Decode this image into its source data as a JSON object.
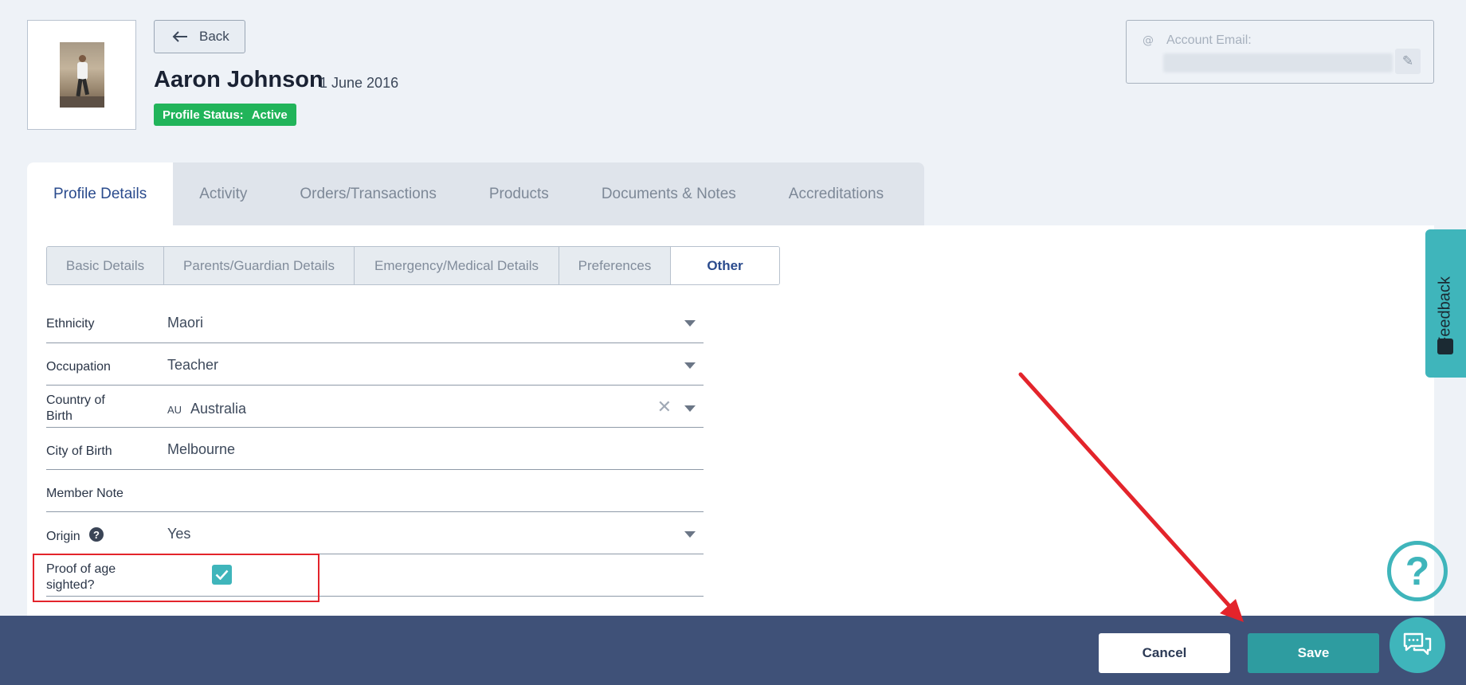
{
  "header": {
    "back_label": "Back",
    "name": "Aaron Johnson",
    "dob": "1 June 2016",
    "status_label": "Profile Status:",
    "status_value": "Active",
    "account_email_label": "Account Email:",
    "account_email_value": "••••••••••••••••••••••••"
  },
  "main_tabs": [
    {
      "label": "Profile Details",
      "active": true
    },
    {
      "label": "Activity"
    },
    {
      "label": "Orders/Transactions"
    },
    {
      "label": "Products"
    },
    {
      "label": "Documents & Notes"
    },
    {
      "label": "Accreditations"
    }
  ],
  "sub_tabs": [
    {
      "label": "Basic Details"
    },
    {
      "label": "Parents/Guardian Details"
    },
    {
      "label": "Emergency/Medical Details"
    },
    {
      "label": "Preferences"
    },
    {
      "label": "Other",
      "active": true
    }
  ],
  "form": {
    "ethnicity": {
      "label": "Ethnicity",
      "value": "Maori"
    },
    "occupation": {
      "label": "Occupation",
      "value": "Teacher"
    },
    "country": {
      "label": "Country of Birth",
      "code": "AU",
      "value": "Australia"
    },
    "city": {
      "label": "City of Birth",
      "value": "Melbourne"
    },
    "member_note": {
      "label": "Member Note",
      "value": ""
    },
    "origin": {
      "label": "Origin",
      "value": "Yes"
    },
    "proof_of_age": {
      "label": "Proof of age sighted?",
      "checked": true
    }
  },
  "footer": {
    "cancel_label": "Cancel",
    "save_label": "Save"
  },
  "widgets": {
    "feedback_label": "Feedback",
    "help_glyph": "?"
  },
  "colors": {
    "accent_teal": "#3fb5bb",
    "status_green": "#21b45a",
    "footer_navy": "#3f5178",
    "annotation_red": "#e3242b"
  }
}
